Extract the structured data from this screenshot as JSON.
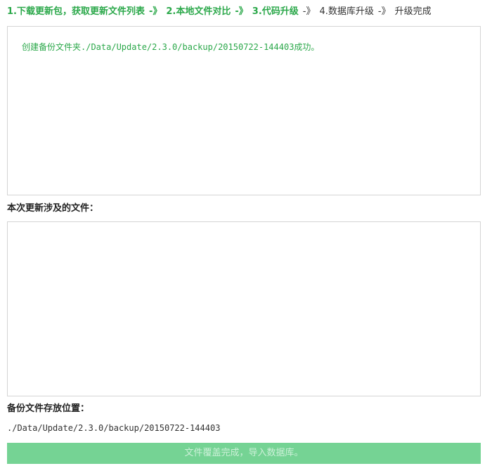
{
  "steps": [
    {
      "label": "1.下载更新包，获取更新文件列表",
      "arrow": "-》",
      "state": "done"
    },
    {
      "label": "2.本地文件对比",
      "arrow": "-》",
      "state": "done"
    },
    {
      "label": "3.代码升级",
      "arrow": "-》",
      "state": "done"
    },
    {
      "label": "4.数据库升级",
      "arrow": "-》",
      "state": "todo"
    },
    {
      "label": "升级完成",
      "arrow": "",
      "state": "todo"
    }
  ],
  "log": {
    "lines": [
      "创建备份文件夹./Data/Update/2.3.0/backup/20150722-144403成功。"
    ]
  },
  "files_section": {
    "title": "本次更新涉及的文件："
  },
  "backup_section": {
    "title": "备份文件存放位置：",
    "path": "./Data/Update/2.3.0/backup/20150722-144403"
  },
  "action": {
    "label": "文件覆盖完成，导入数据库。"
  },
  "colors": {
    "accent": "#2ba84a",
    "button_bg": "#75d394",
    "button_text": "#ccf0d8",
    "border": "#d4d4d4"
  }
}
